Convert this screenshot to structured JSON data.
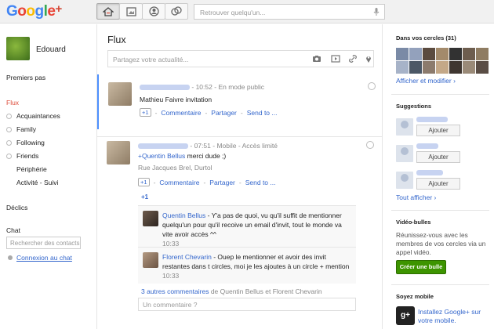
{
  "app": {
    "logo": "Google",
    "logo_plus": "+"
  },
  "search": {
    "placeholder": "Retrouver quelqu'un..."
  },
  "sidebar": {
    "user_name": "Edouard",
    "first_steps": "Premiers pas",
    "stream": "Flux",
    "circles": [
      "Acquaintances",
      "Family",
      "Following",
      "Friends"
    ],
    "periphery": "Périphérie",
    "activity": "Activité - Suivi",
    "sparks": "Déclics",
    "chat": "Chat",
    "chat_placeholder": "Rechercher des contacts",
    "chat_connect": "Connexion au chat"
  },
  "main": {
    "title": "Flux",
    "share_placeholder": "Partagez votre actualité...",
    "posts": [
      {
        "time": "10:52",
        "visibility": "En mode public",
        "text": "Mathieu Faivre invitation",
        "plus_one": "+1",
        "comment": "Commentaire",
        "share": "Partager",
        "send": "Send to ..."
      },
      {
        "time": "07:51",
        "via": "Mobile",
        "visibility": "Accès limité",
        "mention": "+Quentin Bellus",
        "text": "merci dude ;)",
        "location": "Rue Jacques Brel, Durtol",
        "plus_one": "+1",
        "comment": "Commentaire",
        "share": "Partager",
        "send": "Send to ...",
        "plus_count": "+1",
        "comments": [
          {
            "name": "Quentin Bellus",
            "text": " - Y'a pas de quoi, vu qu'il suffit de mentionner quelqu'un pour qu'il recoive un email d'invit, tout le monde va vite avoir accès ^^",
            "time": "10:33"
          },
          {
            "name": "Florent Chevarin",
            "text": " - Ouep le mentionner et avoir des invit restantes dans t circles, moi je les ajoutes à un circle + mention",
            "time": "10:33"
          }
        ],
        "more_comments": "3 autres commentaires",
        "more_comments_by": " de Quentin Bellus et Florent Chevarin",
        "comment_placeholder": "Un commentaire ?"
      }
    ]
  },
  "rightbar": {
    "circles_title": "Dans vos cercles (31)",
    "view_edit": "Afficher et modifier ›",
    "suggestions_title": "Suggestions",
    "add_label": "Ajouter",
    "show_all": "Tout afficher ›",
    "hangouts_title": "Vidéo-bulles",
    "hangouts_text": "Réunissez-vous avec les membres de vos cercles via un appel vidéo.",
    "hangouts_button": "Créer une bulle",
    "mobile_title": "Soyez mobile",
    "mobile_link": "Installez Google+ sur votre mobile."
  },
  "colors": {
    "accent_red": "#dd4b39",
    "link_blue": "#3366cc",
    "green_button": "#3d9400"
  }
}
